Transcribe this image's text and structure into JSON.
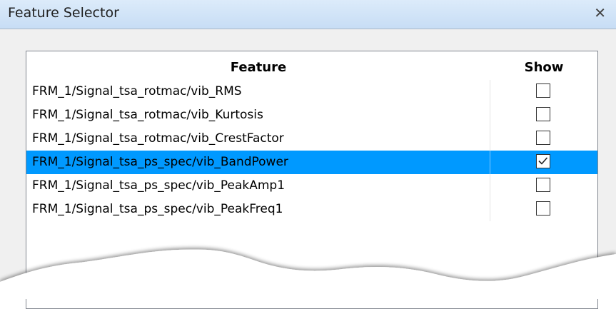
{
  "window": {
    "title": "Feature Selector",
    "close_glyph": "✕"
  },
  "table": {
    "columns": [
      "Feature",
      "Show"
    ],
    "rows": [
      {
        "feature": "FRM_1/Signal_tsa_rotmac/vib_RMS",
        "show": false,
        "selected": false
      },
      {
        "feature": "FRM_1/Signal_tsa_rotmac/vib_Kurtosis",
        "show": false,
        "selected": false
      },
      {
        "feature": "FRM_1/Signal_tsa_rotmac/vib_CrestFactor",
        "show": false,
        "selected": false
      },
      {
        "feature": "FRM_1/Signal_tsa_ps_spec/vib_BandPower",
        "show": true,
        "selected": true
      },
      {
        "feature": "FRM_1/Signal_tsa_ps_spec/vib_PeakAmp1",
        "show": false,
        "selected": false
      },
      {
        "feature": "FRM_1/Signal_tsa_ps_spec/vib_PeakFreq1",
        "show": false,
        "selected": false
      }
    ]
  },
  "colors": {
    "selection": "#0099ff",
    "titlebar": "#c7ddf5"
  }
}
